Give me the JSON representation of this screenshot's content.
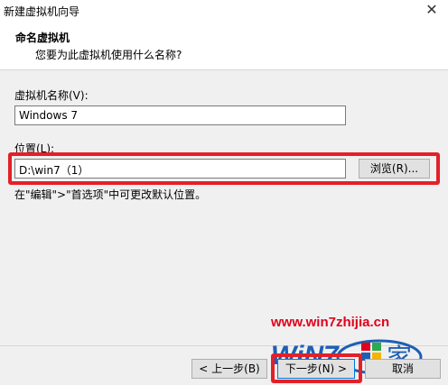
{
  "window": {
    "title": "新建虚拟机向导",
    "close_glyph": "✕"
  },
  "header": {
    "title": "命名虚拟机",
    "subtitle": "您要为此虚拟机使用什么名称?"
  },
  "form": {
    "vm_name_label": "虚拟机名称(V):",
    "vm_name_value": "Windows 7",
    "location_label": "位置(L):",
    "location_value": "D:\\win7（1）",
    "browse_label": "浏览(R)...",
    "hint": "在\"编辑\">\"首选项\"中可更改默认位置。"
  },
  "footer": {
    "back_label": "< 上一步(B)",
    "next_label": "下一步(N) >",
    "cancel_label": "取消"
  },
  "watermark": {
    "url": "www.win7zhijia.cn",
    "logo_text": "WiN7",
    "logo_char": "家"
  },
  "colors": {
    "highlight": "#e32028",
    "focus": "#0078d7",
    "watermark_red": "#e0001b",
    "logo_blue": "#1e5fb4"
  }
}
